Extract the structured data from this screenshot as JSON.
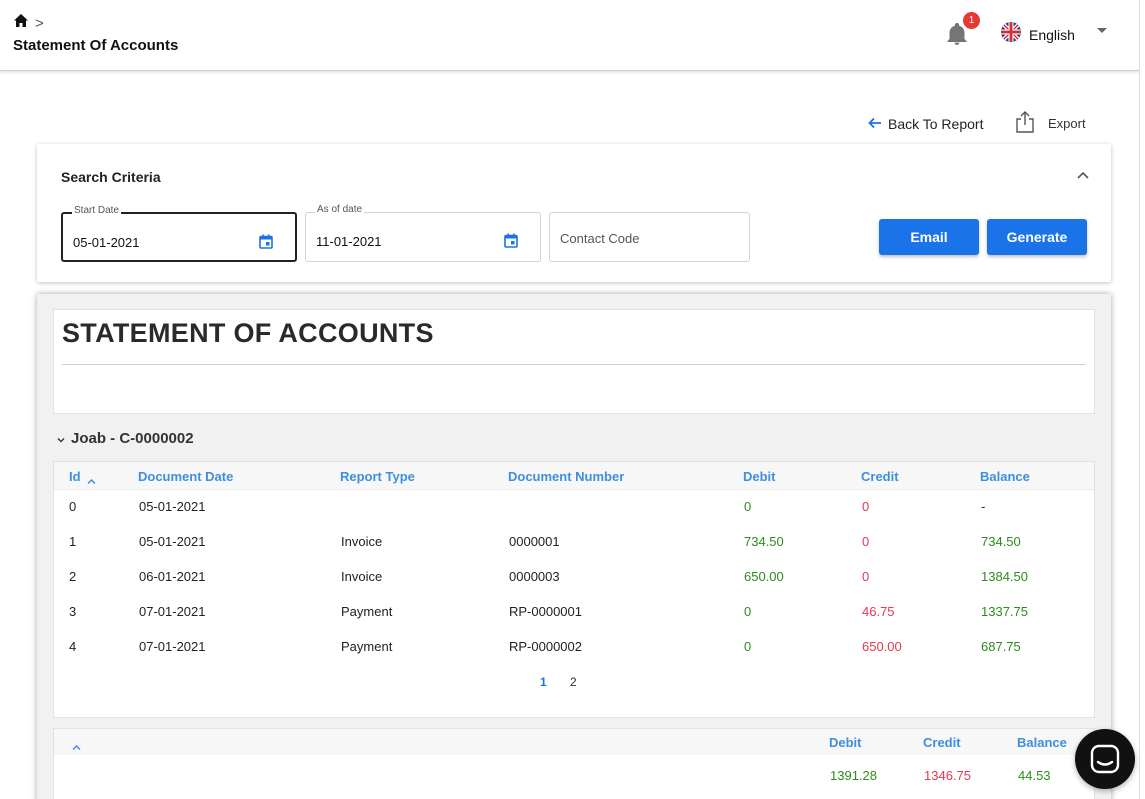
{
  "header": {
    "breadcrumb_sep": ">",
    "page_title": "Statement Of Accounts",
    "notification_count": "1",
    "language": "English"
  },
  "actions": {
    "back_label": "Back To Report",
    "export_label": "Export"
  },
  "search": {
    "title": "Search Criteria",
    "start_date_label": "Start Date",
    "start_date_value": "05-01-2021",
    "as_of_label": "As of date",
    "as_of_value": "11-01-2021",
    "contact_placeholder": "Contact Code",
    "email_label": "Email",
    "generate_label": "Generate"
  },
  "report": {
    "title": "STATEMENT OF ACCOUNTS",
    "group_label": "Joab - C-0000002",
    "columns": [
      "Id",
      "Document Date",
      "Report Type",
      "Document Number",
      "Debit",
      "Credit",
      "Balance"
    ],
    "rows": [
      {
        "id": "0",
        "date": "05-01-2021",
        "type": "",
        "number": "",
        "debit": "0",
        "credit": "0",
        "balance": "-"
      },
      {
        "id": "1",
        "date": "05-01-2021",
        "type": "Invoice",
        "number": "0000001",
        "debit": "734.50",
        "credit": "0",
        "balance": "734.50"
      },
      {
        "id": "2",
        "date": "06-01-2021",
        "type": "Invoice",
        "number": "0000003",
        "debit": "650.00",
        "credit": "0",
        "balance": "1384.50"
      },
      {
        "id": "3",
        "date": "07-01-2021",
        "type": "Payment",
        "number": "RP-0000001",
        "debit": "0",
        "credit": "46.75",
        "balance": "1337.75"
      },
      {
        "id": "4",
        "date": "07-01-2021",
        "type": "Payment",
        "number": "RP-0000002",
        "debit": "0",
        "credit": "650.00",
        "balance": "687.75"
      }
    ],
    "pages": [
      "1",
      "2"
    ],
    "totals": {
      "debit_label": "Debit",
      "credit_label": "Credit",
      "balance_label": "Balance",
      "debit": "1391.28",
      "credit": "1346.75",
      "balance": "44.53"
    }
  },
  "colors": {
    "accent": "#1a73e8",
    "positive": "#2e8b1f",
    "negative": "#e53950",
    "header_text": "#3d8fe0"
  }
}
